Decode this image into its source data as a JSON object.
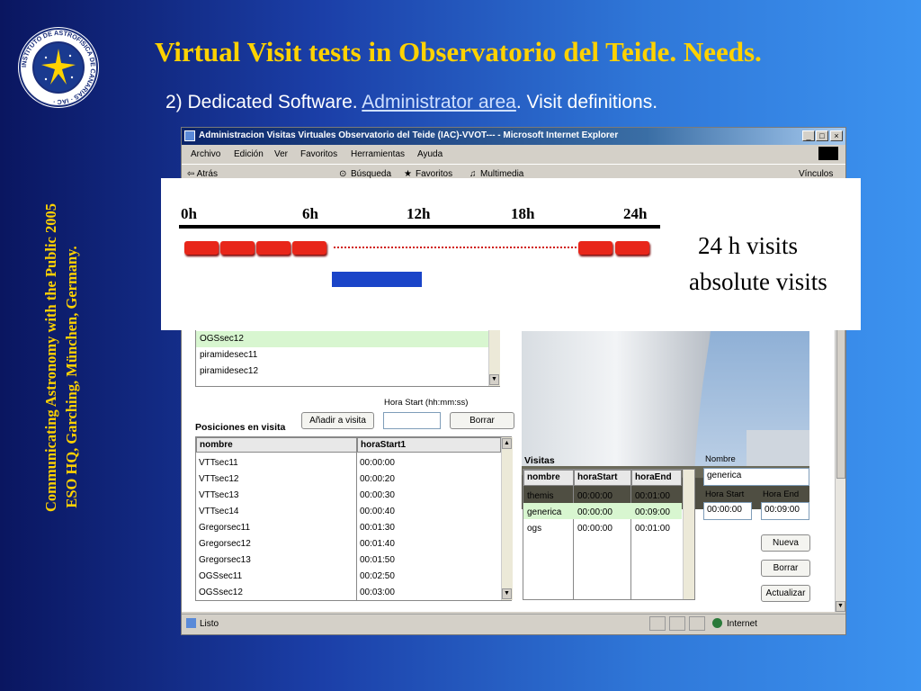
{
  "slide": {
    "title": "Virtual Visit tests in Observatorio del Teide. Needs.",
    "subtitle_prefix": "2) Dedicated Software. ",
    "subtitle_link": "Administrator area",
    "subtitle_suffix": ". Visit definitions.",
    "side_line1": "Communicating Astronomy with the Public 2005",
    "side_line2": "ESO HQ, Garching, München, Germany.",
    "logo_text": "INSTITUTO DE ASTROFISICA DE CANARIAS · IAC ·"
  },
  "browser": {
    "window_title": "Administracion Visitas Virtuales Observatorio del Teide (IAC)-VVOT--- - Microsoft Internet Explorer",
    "menu": [
      "Archivo",
      "Edición",
      "Ver",
      "Favoritos",
      "Herramientas",
      "Ayuda"
    ],
    "toolbar": {
      "back": "⇦ Atrás",
      "search": "Búsqueda",
      "favorites": "Favoritos",
      "media": "Multimedia",
      "links": "Vínculos"
    },
    "status": {
      "text": "Listo",
      "zone": "Internet"
    }
  },
  "app": {
    "top_list": [
      "OGSsec12",
      "piramidesec11",
      "piramidesec12"
    ],
    "hora_start_label": "Hora Start (hh:mm:ss)",
    "add_button": "Añadir a visita",
    "delete_button": "Borrar",
    "positions_title": "Posiciones en visita",
    "positions_columns": [
      "nombre",
      "horaStart1"
    ],
    "positions_rows": [
      [
        "VTTsec11",
        "00:00:00"
      ],
      [
        "VTTsec12",
        "00:00:20"
      ],
      [
        "VTTsec13",
        "00:00:30"
      ],
      [
        "VTTsec14",
        "00:00:40"
      ],
      [
        "Gregorsec11",
        "00:01:30"
      ],
      [
        "Gregorsec12",
        "00:01:40"
      ],
      [
        "Gregorsec13",
        "00:01:50"
      ],
      [
        "OGSsec11",
        "00:02:50"
      ],
      [
        "OGSsec12",
        "00:03:00"
      ]
    ],
    "visits_title": "Visitas",
    "visits_columns": [
      "nombre",
      "horaStart",
      "horaEnd"
    ],
    "visits_rows": [
      [
        "themis",
        "00:00:00",
        "00:01:00"
      ],
      [
        "generica",
        "00:00:00",
        "00:09:00"
      ],
      [
        "ogs",
        "00:00:00",
        "00:01:00"
      ]
    ],
    "nombre_label": "Nombre",
    "nombre_value": "generica",
    "hora_start_short": "Hora Start",
    "hora_end_short": "Hora End",
    "hora_start_value": "00:00:00",
    "hora_end_value": "00:09:00",
    "new_button": "Nueva",
    "delete2_button": "Borrar",
    "update_button": "Actualizar"
  },
  "overlay": {
    "ticks": [
      "0h",
      "6h",
      "12h",
      "18h",
      "24h"
    ],
    "text1": "24 h visits",
    "text2": "absolute visits",
    "colors": {
      "red": "#e8261a",
      "blue": "#1a44c8"
    }
  }
}
